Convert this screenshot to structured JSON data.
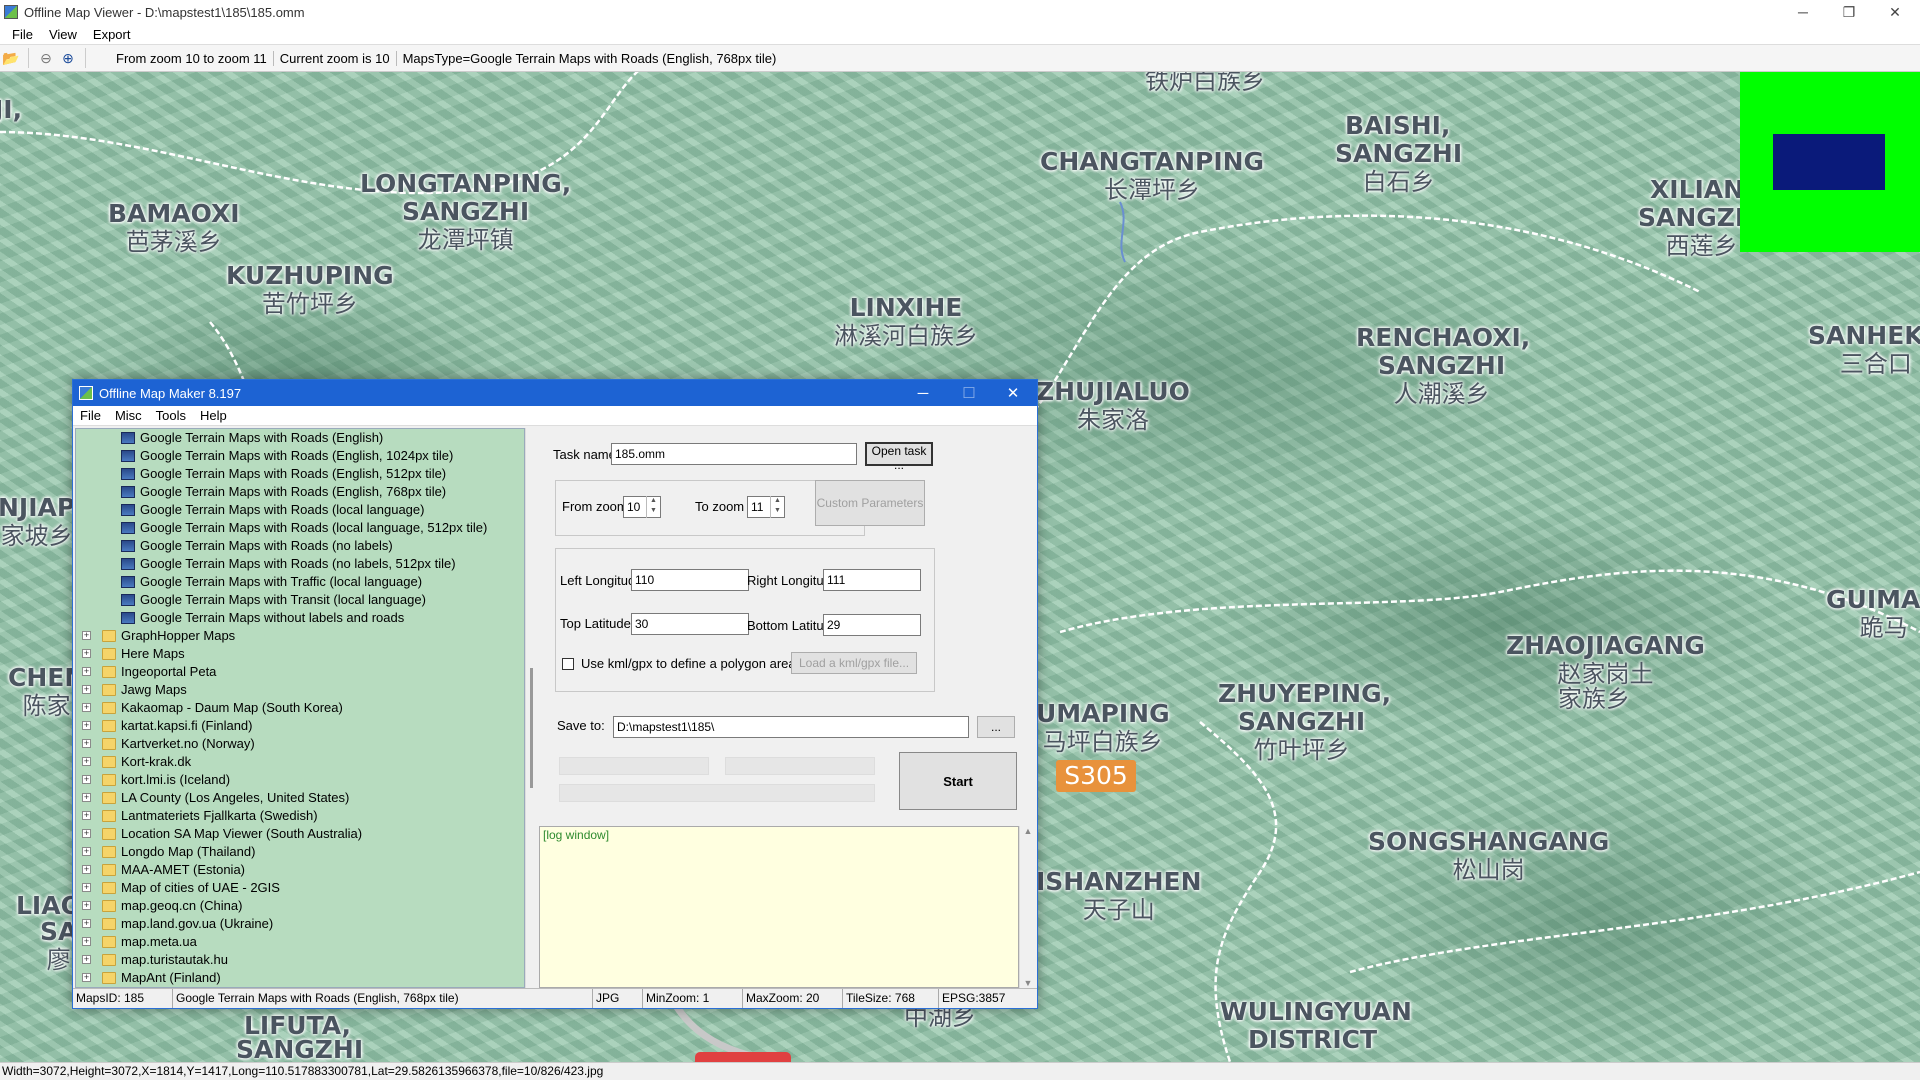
{
  "window": {
    "title": "Offline Map Viewer - D:\\mapstest1\\185\\185.omm",
    "controls": {
      "minimize": "─",
      "maximize": "❐",
      "close": "✕"
    }
  },
  "menu": [
    "File",
    "View",
    "Export"
  ],
  "toolbar": {
    "info_from_to": "From zoom 10 to zoom 11",
    "info_current": "Current zoom is 10",
    "info_maptype": "MapsType=Google Terrain Maps with Roads (English, 768px tile)"
  },
  "map": {
    "labels": [
      {
        "en": "",
        "cn": "铁炉白族乡"
      },
      {
        "en": "BAISHI,",
        "cn": ""
      },
      {
        "en": "SANGZHI",
        "cn": "白石乡"
      },
      {
        "en": "CHANGTANPING",
        "cn": "长潭坪乡"
      },
      {
        "en": "LONGTANPING,",
        "cn": ""
      },
      {
        "en": "SANGZHI",
        "cn": "龙潭坪镇"
      },
      {
        "en": "BAMAOXI",
        "cn": "芭茅溪乡"
      },
      {
        "en": "KUZHUPING",
        "cn": "苦竹坪乡"
      },
      {
        "en": "XILIAN,",
        "cn": ""
      },
      {
        "en": "SANGZHI",
        "cn": "西莲乡"
      },
      {
        "en": "LINXIHE",
        "cn": "淋溪河白族乡"
      },
      {
        "en": "RENCHAOXI,",
        "cn": ""
      },
      {
        "en": "SANGZHI",
        "cn": "人潮溪乡"
      },
      {
        "en": "SANHEKO",
        "cn": "三合口"
      },
      {
        "en": "ZHUJIALUO",
        "cn": "朱家洛"
      },
      {
        "en": "NJIAP",
        "cn": "家坡乡"
      },
      {
        "en": "GUIMAN",
        "cn": "跪马"
      },
      {
        "en": "ZHAOJIAGANG",
        "cn": "赵家岗土"
      },
      {
        "en": "",
        "cn": "家族乡"
      },
      {
        "en": "CHEN",
        "cn": "陈家"
      },
      {
        "en": "ZHUYEPING,",
        "cn": ""
      },
      {
        "en": "SANGZHI",
        "cn": "竹叶坪乡"
      },
      {
        "en": "UMAPING",
        "cn": "马坪白族乡"
      },
      {
        "en": "SONGSHANGANG",
        "cn": "松山岗"
      },
      {
        "en": "ISHANZHEN",
        "cn": "天子山"
      },
      {
        "en": "LIAO",
        "cn": ""
      },
      {
        "en": "SA",
        "cn": "廖"
      },
      {
        "en": "LIFUTA,",
        "cn": ""
      },
      {
        "en": "SANGZHI",
        "cn": ""
      },
      {
        "en": "",
        "cn": "中湖乡"
      },
      {
        "en": "WULINGYUAN",
        "cn": ""
      },
      {
        "en": "DISTRICT",
        "cn": ""
      },
      {
        "en": "JI,",
        "cn": ""
      }
    ],
    "road_badge": "S305",
    "colors": {
      "terrain": "#9ccab0",
      "minimap_bg": "#00ff00",
      "minimap_viewport": "#0a1a7a",
      "road_badge": "#e8923c"
    }
  },
  "statusbar": "Width=3072,Height=3072,X=1814,Y=1417,Long=110.517883300781,Lat=29.5826135966378,file=10/826/423.jpg",
  "dialog": {
    "title": "Offline Map Maker 8.197",
    "controls": {
      "minimize": "─",
      "maximize": "☐",
      "close": "✕"
    },
    "menu": [
      "File",
      "Misc",
      "Tools",
      "Help"
    ],
    "tree": {
      "children": [
        "Google Terrain Maps with Roads (English)",
        "Google Terrain Maps with Roads (English, 1024px tile)",
        "Google Terrain Maps with Roads (English, 512px tile)",
        "Google Terrain Maps with Roads (English, 768px tile)",
        "Google Terrain Maps with Roads (local language)",
        "Google Terrain Maps with Roads (local language, 512px tile)",
        "Google Terrain Maps with Roads (no labels)",
        "Google Terrain Maps with Roads (no labels, 512px tile)",
        "Google Terrain Maps with Traffic (local language)",
        "Google Terrain Maps with Transit (local language)",
        "Google Terrain Maps without labels and roads"
      ],
      "folders": [
        "GraphHopper Maps",
        "Here Maps",
        "Ingeoportal Peta",
        "Jawg Maps",
        "Kakaomap - Daum Map (South Korea)",
        "kartat.kapsi.fi (Finland)",
        "Kartverket.no (Norway)",
        "Kort-krak.dk",
        "kort.lmi.is (Iceland)",
        "LA County (Los Angeles, United States)",
        "Lantmateriets Fjallkarta (Swedish)",
        "Location SA Map Viewer (South Australia)",
        "Longdo Map (Thailand)",
        "MAA-AMET (Estonia)",
        "Map of cities of UAE - 2GIS",
        "map.geoq.cn (China)",
        "map.land.gov.ua (Ukraine)",
        "map.meta.ua",
        "map.turistautak.hu",
        "MapAnt (Finland)"
      ],
      "selected_color": "#b7dcbf"
    },
    "form": {
      "task_name_label": "Task name",
      "task_name_value": "185.omm",
      "open_task_button": "Open task ...",
      "from_zoom_label": "From zoom",
      "from_zoom_value": "10",
      "to_zoom_label": "To zoom",
      "to_zoom_value": "11",
      "custom_params_button": "Custom Parameters",
      "left_lon_label": "Left Longitude",
      "left_lon_value": "110",
      "right_lon_label": "Right Longitude",
      "right_lon_value": "111",
      "top_lat_label": "Top Latitude",
      "top_lat_value": "30",
      "bottom_lat_label": "Bottom Latitude",
      "bottom_lat_value": "29",
      "use_kml_label": "Use kml/gpx to define a polygon area",
      "load_kml_button": "Load a kml/gpx file...",
      "save_to_label": "Save to:",
      "save_to_value": "D:\\mapstest1\\185\\",
      "browse_button": "...",
      "start_button": "Start"
    },
    "log": "[log window]",
    "status": {
      "maps_id": "MapsID: 185",
      "map_name": "Google Terrain Maps with Roads (English, 768px tile)",
      "format": "JPG",
      "min_zoom": "MinZoom: 1",
      "max_zoom": "MaxZoom: 20",
      "tile_size": "TileSize: 768",
      "epsg": "EPSG:3857"
    }
  }
}
